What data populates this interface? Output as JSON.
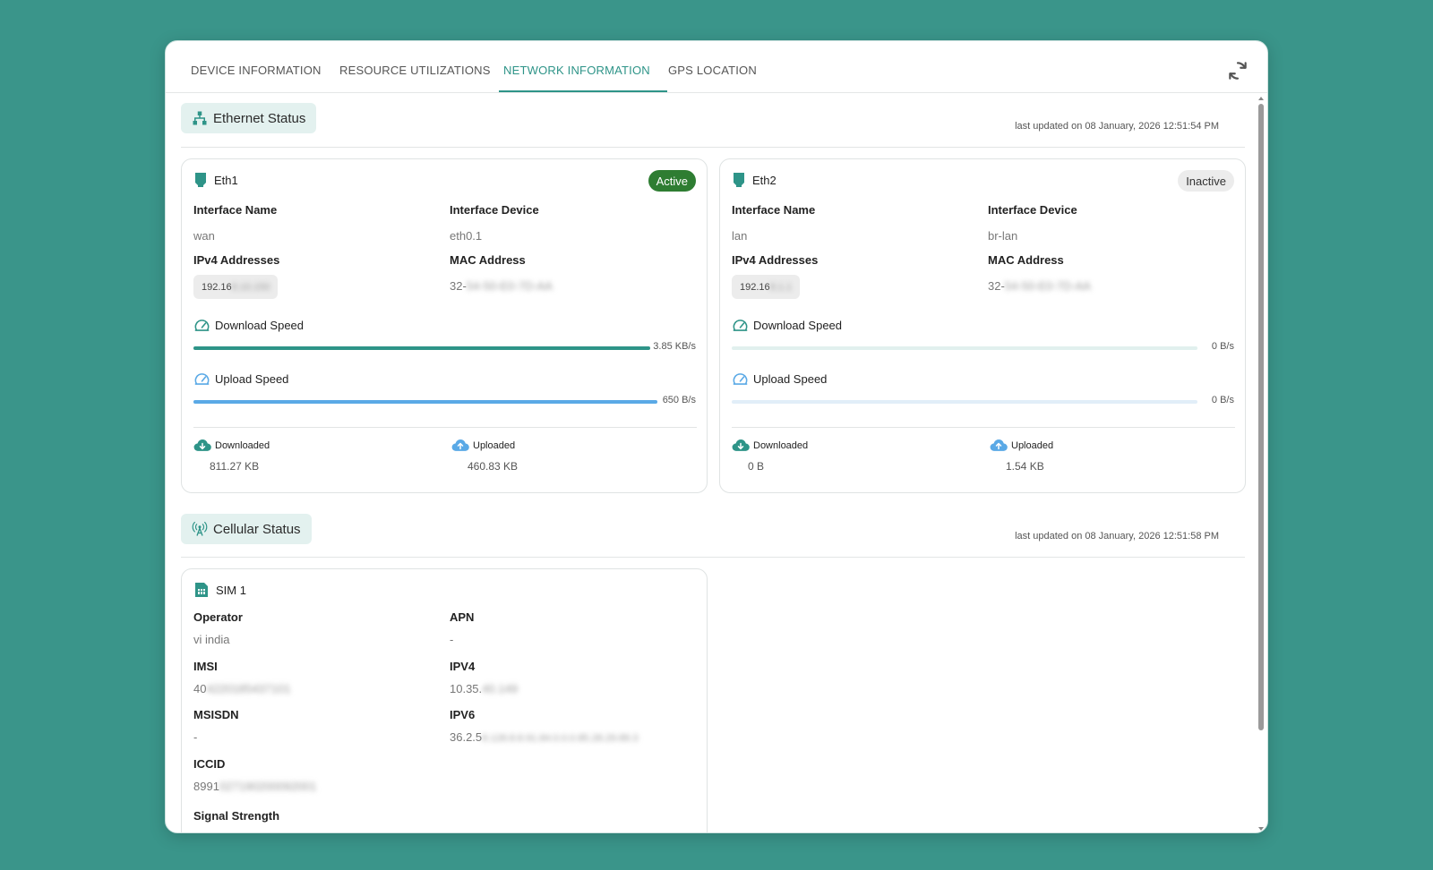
{
  "tabs": [
    {
      "label": "DEVICE INFORMATION"
    },
    {
      "label": "RESOURCE UTILIZATIONS"
    },
    {
      "label": "NETWORK INFORMATION"
    },
    {
      "label": "GPS LOCATION"
    }
  ],
  "active_tab": "NETWORK INFORMATION",
  "accent_color": "#2e9488",
  "ethernet": {
    "title": "Ethernet Status",
    "updated": "last updated on 08 January, 2026 12:51:54 PM",
    "cards": [
      {
        "name": "Eth1",
        "status": "Active",
        "interface_name_label": "Interface Name",
        "interface_name": "wan",
        "interface_device_label": "Interface Device",
        "interface_device": "eth0.1",
        "ipv4_label": "IPv4 Addresses",
        "ipv4_visible": "192.16",
        "ipv4_hidden": "8.10.150",
        "mac_label": "MAC Address",
        "mac_visible": "32-",
        "mac_hidden": "54-50-E0-7D-AA",
        "download_label": "Download Speed",
        "download_speed": "3.85 KB/s",
        "download_fraction": 1.0,
        "upload_label": "Upload Speed",
        "upload_speed": "650 B/s",
        "upload_fraction": 1.0,
        "downloaded_label": "Downloaded",
        "downloaded": "811.27 KB",
        "uploaded_label": "Uploaded",
        "uploaded": "460.83 KB"
      },
      {
        "name": "Eth2",
        "status": "Inactive",
        "interface_name_label": "Interface Name",
        "interface_name": "lan",
        "interface_device_label": "Interface Device",
        "interface_device": "br-lan",
        "ipv4_label": "IPv4 Addresses",
        "ipv4_visible": "192.16",
        "ipv4_hidden": "8.1.1",
        "mac_label": "MAC Address",
        "mac_visible": "32-",
        "mac_hidden": "54-50-E0-7D-AA",
        "download_label": "Download Speed",
        "download_speed": "0 B/s",
        "download_fraction": 0,
        "upload_label": "Upload Speed",
        "upload_speed": "0 B/s",
        "upload_fraction": 0,
        "downloaded_label": "Downloaded",
        "downloaded": "0 B",
        "uploaded_label": "Uploaded",
        "uploaded": "1.54 KB"
      }
    ]
  },
  "cellular": {
    "title": "Cellular Status",
    "updated": "last updated on 08 January, 2026 12:51:58 PM",
    "sim": {
      "name": "SIM 1",
      "operator_label": "Operator",
      "operator": "vi india",
      "apn_label": "APN",
      "apn": "-",
      "imsi_label": "IMSI",
      "imsi_visible": "40",
      "imsi_hidden": "4220185437101",
      "ipv4_label": "IPV4",
      "ipv4_visible": "10.35.",
      "ipv4_hidden": "40.149",
      "msisdn_label": "MSISDN",
      "msisdn": "-",
      "ipv6_label": "IPV6",
      "ipv6_visible": "36.2.5",
      "ipv6_hidden": "8.128.8.8.91.84.0.0.0.85.28.29.89.3",
      "iccid_label": "ICCID",
      "iccid_visible": "8991",
      "iccid_hidden": "027190200092001",
      "signal_label": "Signal Strength"
    }
  }
}
